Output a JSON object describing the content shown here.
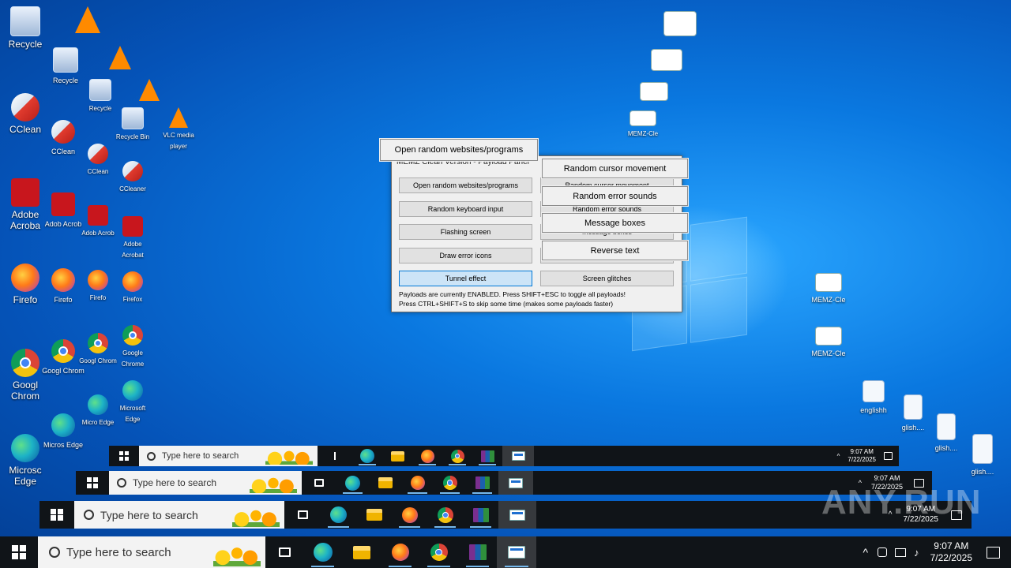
{
  "desktop": {
    "icons_col1": [
      {
        "label": "Recycle",
        "icon": "recycle-bin-icon"
      },
      {
        "label": "CClean",
        "icon": "ccleaner-icon"
      },
      {
        "label": "Adobe Acroba",
        "icon": "acrobat-icon"
      },
      {
        "label": "Firefo",
        "icon": "firefox-icon"
      },
      {
        "label": "Googl Chrom",
        "icon": "chrome-icon"
      },
      {
        "label": "Microsc Edge",
        "icon": "edge-icon"
      }
    ],
    "icons_col2": [
      {
        "label": "Recycle",
        "icon": "recycle-bin-icon"
      },
      {
        "label": "CClean",
        "icon": "ccleaner-icon"
      },
      {
        "label": "Adob Acrob",
        "icon": "acrobat-icon"
      },
      {
        "label": "Firefo",
        "icon": "firefox-icon"
      },
      {
        "label": "Googl Chrom",
        "icon": "chrome-icon"
      },
      {
        "label": "Micros Edge",
        "icon": "edge-icon"
      }
    ],
    "icons_col3": [
      {
        "label": "Recycle",
        "icon": "recycle-bin-icon"
      },
      {
        "label": "CClean",
        "icon": "ccleaner-icon"
      },
      {
        "label": "Adob Acrob",
        "icon": "acrobat-icon"
      },
      {
        "label": "Firefo",
        "icon": "firefox-icon"
      },
      {
        "label": "Googl Chrom",
        "icon": "chrome-icon"
      },
      {
        "label": "Micro Edge",
        "icon": "edge-icon"
      }
    ],
    "icons_col4": [
      {
        "label": "Recycle Bin",
        "icon": "recycle-bin-icon"
      },
      {
        "label": "CCleaner",
        "icon": "ccleaner-icon"
      },
      {
        "label": "Adobe Acrobat",
        "icon": "acrobat-icon"
      },
      {
        "label": "Firefox",
        "icon": "firefox-icon"
      },
      {
        "label": "Google Chrome",
        "icon": "chrome-icon"
      },
      {
        "label": "Microsoft Edge",
        "icon": "edge-icon"
      }
    ],
    "vlc_label": "VLC media player",
    "right_icons": [
      {
        "label": "MEMZ-Cle",
        "icon": "gear-window-icon"
      },
      {
        "label": "MEMZ-Cle",
        "icon": "gear-window-icon"
      },
      {
        "label": "MEMZ-Cle",
        "icon": "gear-window-icon"
      },
      {
        "label": "englishh",
        "icon": "image-icon"
      },
      {
        "label": "glish....",
        "icon": "document-icon"
      },
      {
        "label": "glish....",
        "icon": "document-icon"
      },
      {
        "label": "glish....",
        "icon": "document-icon"
      }
    ]
  },
  "panel": {
    "title": "MEMZ Clean Version - Payload Panel",
    "left_buttons": [
      "Open random websites/programs",
      "Random keyboard input",
      "Flashing screen",
      "Draw error icons",
      "Tunnel effect"
    ],
    "right_buttons": [
      "Random cursor movement",
      "Random error sounds",
      "Message boxes",
      "Reverse text",
      "Screen glitches"
    ],
    "note1": "Payloads are currently ENABLED. Press SHIFT+ESC to toggle all payloads!",
    "note2": "Press CTRL+SHIFT+S to skip some time (makes some payloads faster)"
  },
  "floating_buttons": {
    "open_random": "Open random websites/programs",
    "cursor": "Random cursor movement",
    "sounds": "Random error sounds",
    "boxes": "Message boxes",
    "reverse": "Reverse text"
  },
  "taskbar": {
    "search_placeholder": "Type here to search",
    "time": "9:07 AM",
    "date": "7/22/2025",
    "apps": [
      "edge-icon",
      "file-explorer-icon",
      "firefox-icon",
      "chrome-icon",
      "winrar-icon",
      "memz-panel-icon"
    ]
  },
  "watermark": "ANY.RUN"
}
